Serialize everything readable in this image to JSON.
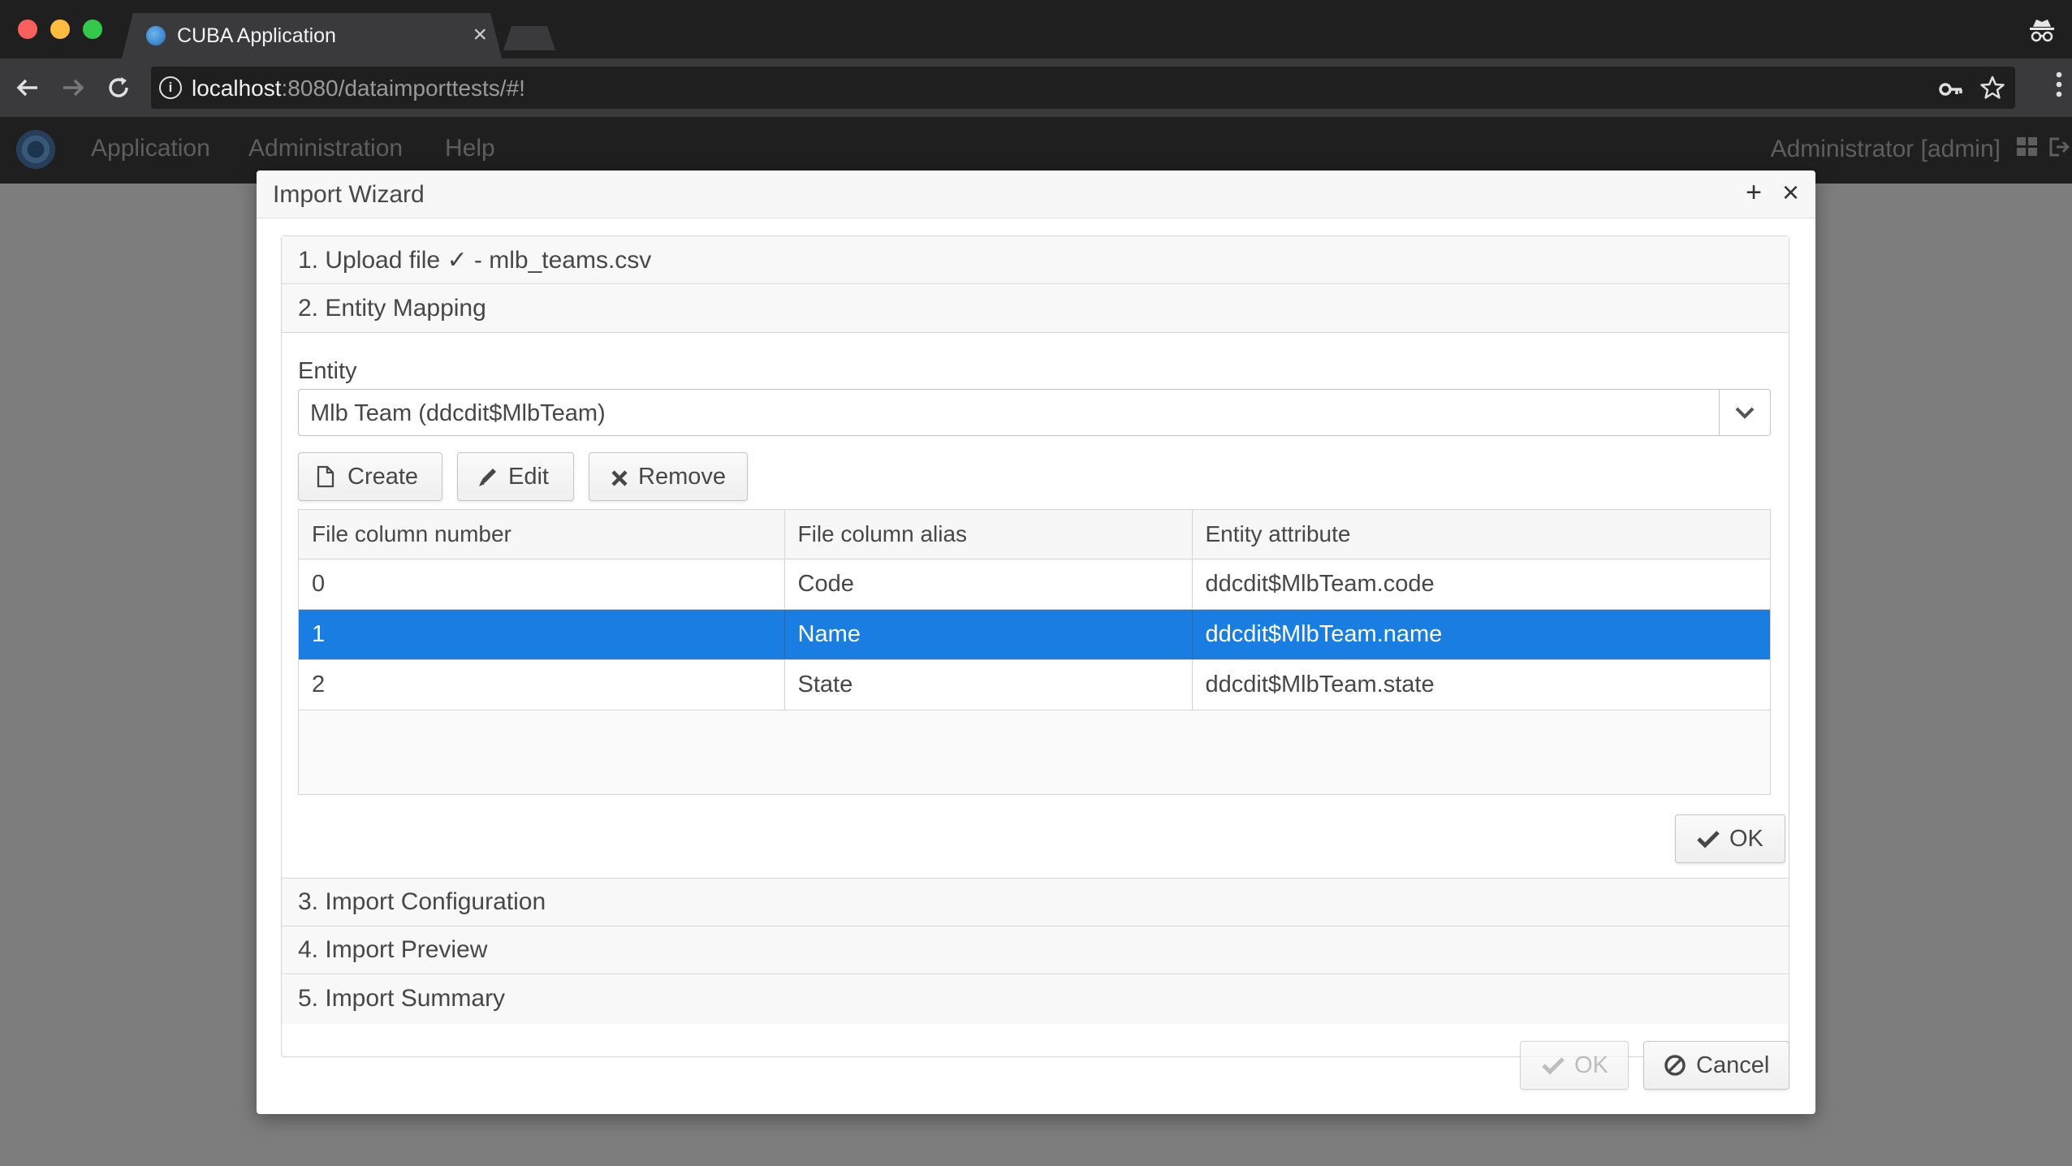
{
  "browser": {
    "tab_title": "CUBA Application",
    "tab_close": "×",
    "url_host": "localhost",
    "url_rest": ":8080/dataimporttests/#!"
  },
  "app": {
    "menu": [
      "Application",
      "Administration",
      "Help"
    ],
    "user": "Administrator [admin]"
  },
  "dialog": {
    "title": "Import Wizard",
    "maximize": "+",
    "close": "×",
    "steps": {
      "step1": "1. Upload file ✓ - mlb_teams.csv",
      "step2": "2. Entity Mapping",
      "step3": "3. Import Configuration",
      "step4": "4. Import Preview",
      "step5": "5. Import Summary"
    },
    "entity_label": "Entity",
    "entity_value": "Mlb Team (ddcdit$MlbTeam)",
    "buttons": {
      "create": "Create",
      "edit": "Edit",
      "remove": "Remove",
      "step_ok": "OK",
      "ok": "OK",
      "cancel": "Cancel"
    },
    "table": {
      "headers": [
        "File column number",
        "File column alias",
        "Entity attribute"
      ],
      "rows": [
        [
          "0",
          "Code",
          "ddcdit$MlbTeam.code"
        ],
        [
          "1",
          "Name",
          "ddcdit$MlbTeam.name"
        ],
        [
          "2",
          "State",
          "ddcdit$MlbTeam.state"
        ]
      ],
      "selected_row": 1
    }
  },
  "colors": {
    "selection": "#197de1",
    "overlay": "#7d7d7d",
    "chrome_dark": "#1f1f20"
  }
}
